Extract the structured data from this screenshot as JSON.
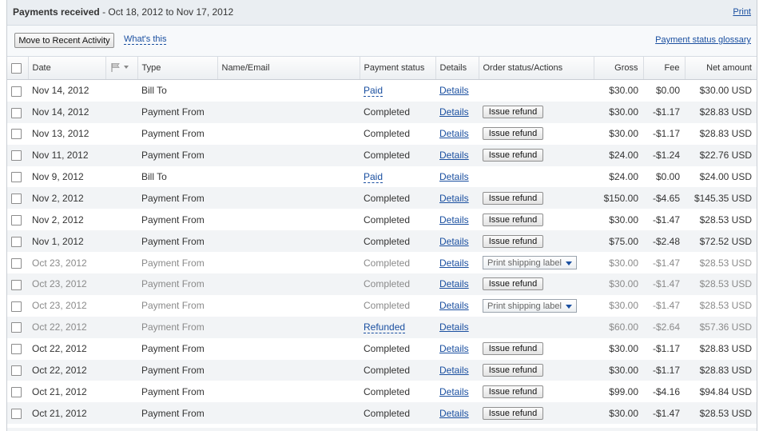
{
  "header": {
    "title": "Payments received",
    "date_range": "- Oct 18, 2012 to Nov 17, 2012",
    "print_label": "Print"
  },
  "toolbar": {
    "move_button": "Move to Recent Activity",
    "whats_this": "What's this",
    "glossary": "Payment status glossary"
  },
  "columns": {
    "date": "Date",
    "type": "Type",
    "name_email": "Name/Email",
    "payment_status": "Payment status",
    "details": "Details",
    "order_status": "Order status/Actions",
    "gross": "Gross",
    "fee": "Fee",
    "net": "Net amount"
  },
  "icons": {
    "flag": "flag-icon",
    "checkbox": "checkbox-icon",
    "dropdown": "dropdown-caret-icon"
  },
  "colors": {
    "link": "#1a4fa0",
    "row_alt": "#f2f4f6",
    "header_bg": "#eaeef2"
  },
  "rows": [
    {
      "date": "Nov 14, 2012",
      "type": "Bill To",
      "status": "Paid",
      "status_link": true,
      "details": "Details",
      "action": "",
      "action_kind": "none",
      "gross": "$30.00",
      "fee": "$0.00",
      "net": "$30.00 USD",
      "dim": false
    },
    {
      "date": "Nov 14, 2012",
      "type": "Payment From",
      "status": "Completed",
      "status_link": false,
      "details": "Details",
      "action": "Issue refund",
      "action_kind": "button",
      "gross": "$30.00",
      "fee": "-$1.17",
      "net": "$28.83 USD",
      "dim": false
    },
    {
      "date": "Nov 13, 2012",
      "type": "Payment From",
      "status": "Completed",
      "status_link": false,
      "details": "Details",
      "action": "Issue refund",
      "action_kind": "button",
      "gross": "$30.00",
      "fee": "-$1.17",
      "net": "$28.83 USD",
      "dim": false
    },
    {
      "date": "Nov 11, 2012",
      "type": "Payment From",
      "status": "Completed",
      "status_link": false,
      "details": "Details",
      "action": "Issue refund",
      "action_kind": "button",
      "gross": "$24.00",
      "fee": "-$1.24",
      "net": "$22.76 USD",
      "dim": false
    },
    {
      "date": "Nov 9, 2012",
      "type": "Bill To",
      "status": "Paid",
      "status_link": true,
      "details": "Details",
      "action": "",
      "action_kind": "none",
      "gross": "$24.00",
      "fee": "$0.00",
      "net": "$24.00 USD",
      "dim": false
    },
    {
      "date": "Nov 2, 2012",
      "type": "Payment From",
      "status": "Completed",
      "status_link": false,
      "details": "Details",
      "action": "Issue refund",
      "action_kind": "button",
      "gross": "$150.00",
      "fee": "-$4.65",
      "net": "$145.35 USD",
      "dim": false
    },
    {
      "date": "Nov 2, 2012",
      "type": "Payment From",
      "status": "Completed",
      "status_link": false,
      "details": "Details",
      "action": "Issue refund",
      "action_kind": "button",
      "gross": "$30.00",
      "fee": "-$1.47",
      "net": "$28.53 USD",
      "dim": false
    },
    {
      "date": "Nov 1, 2012",
      "type": "Payment From",
      "status": "Completed",
      "status_link": false,
      "details": "Details",
      "action": "Issue refund",
      "action_kind": "button",
      "gross": "$75.00",
      "fee": "-$2.48",
      "net": "$72.52 USD",
      "dim": false
    },
    {
      "date": "Oct 23, 2012",
      "type": "Payment From",
      "status": "Completed",
      "status_link": false,
      "details": "Details",
      "action": "Print shipping label",
      "action_kind": "select",
      "gross": "$30.00",
      "fee": "-$1.47",
      "net": "$28.53 USD",
      "dim": true
    },
    {
      "date": "Oct 23, 2012",
      "type": "Payment From",
      "status": "Completed",
      "status_link": false,
      "details": "Details",
      "action": "Issue refund",
      "action_kind": "button",
      "gross": "$30.00",
      "fee": "-$1.47",
      "net": "$28.53 USD",
      "dim": true
    },
    {
      "date": "Oct 23, 2012",
      "type": "Payment From",
      "status": "Completed",
      "status_link": false,
      "details": "Details",
      "action": "Print shipping label",
      "action_kind": "select",
      "gross": "$30.00",
      "fee": "-$1.47",
      "net": "$28.53 USD",
      "dim": true
    },
    {
      "date": "Oct 22, 2012",
      "type": "Payment From",
      "status": "Refunded",
      "status_link": true,
      "details": "Details",
      "action": "",
      "action_kind": "none",
      "gross": "$60.00",
      "fee": "-$2.64",
      "net": "$57.36 USD",
      "dim": true
    },
    {
      "date": "Oct 22, 2012",
      "type": "Payment From",
      "status": "Completed",
      "status_link": false,
      "details": "Details",
      "action": "Issue refund",
      "action_kind": "button",
      "gross": "$30.00",
      "fee": "-$1.17",
      "net": "$28.83 USD",
      "dim": false
    },
    {
      "date": "Oct 22, 2012",
      "type": "Payment From",
      "status": "Completed",
      "status_link": false,
      "details": "Details",
      "action": "Issue refund",
      "action_kind": "button",
      "gross": "$30.00",
      "fee": "-$1.17",
      "net": "$28.83 USD",
      "dim": false
    },
    {
      "date": "Oct 21, 2012",
      "type": "Payment From",
      "status": "Completed",
      "status_link": false,
      "details": "Details",
      "action": "Issue refund",
      "action_kind": "button",
      "gross": "$99.00",
      "fee": "-$4.16",
      "net": "$94.84 USD",
      "dim": false
    },
    {
      "date": "Oct 21, 2012",
      "type": "Payment From",
      "status": "Completed",
      "status_link": false,
      "details": "Details",
      "action": "Issue refund",
      "action_kind": "button",
      "gross": "$30.00",
      "fee": "-$1.47",
      "net": "$28.53 USD",
      "dim": false
    }
  ]
}
